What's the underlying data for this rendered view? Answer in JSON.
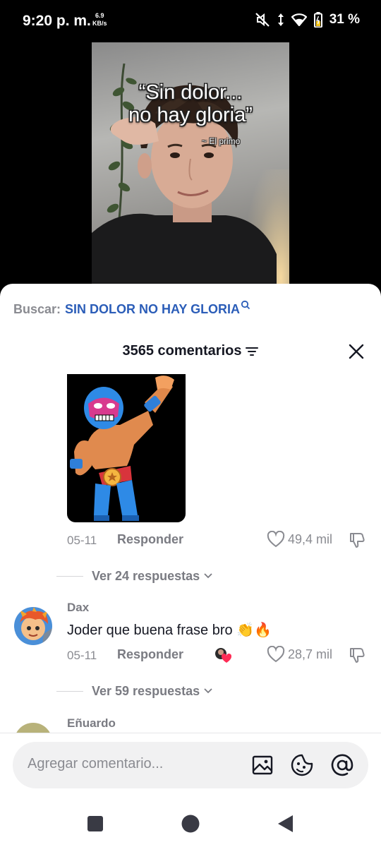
{
  "status_bar": {
    "time": "9:20 p. m.",
    "speed_value": "6.9",
    "speed_unit": "KB/s",
    "battery": "31 %"
  },
  "video": {
    "quote_line1": "“Sin dolor...",
    "quote_line2": "no hay gloria”",
    "quote_author": "~ El primo"
  },
  "search": {
    "prefix": "Buscar:",
    "query": "SIN DOLOR NO HAY GLORIA"
  },
  "comments_header": {
    "title": "3565 comentarios"
  },
  "thread": {
    "first_comment": {
      "date": "05-11",
      "reply_label": "Responder",
      "likes": "49,4 mil",
      "view_replies": "Ver 24 respuestas"
    },
    "second_comment": {
      "username": "Dax",
      "text": "Joder que buena frase bro 👏🔥",
      "date": "05-11",
      "reply_label": "Responder",
      "likes": "28,7 mil",
      "view_replies": "Ver 59 respuestas"
    },
    "third_comment": {
      "username": "Eñuardo"
    }
  },
  "input": {
    "placeholder": "Agregar comentario..."
  },
  "colors": {
    "accent_link": "#2b5db8",
    "muted_text": "#8a8b91",
    "primary_text": "#161823",
    "creator_heart": "#fe2c55"
  },
  "icons": {
    "status": [
      "mute-icon",
      "data-arrows-icon",
      "wifi-icon",
      "battery-icon"
    ],
    "header": [
      "filter-icon",
      "close-icon"
    ],
    "comment": [
      "heart-outline-icon",
      "dislike-icon",
      "chevron-down-icon"
    ],
    "input": [
      "image-icon",
      "emoji-icon",
      "mention-icon"
    ],
    "nav": [
      "recents-square-icon",
      "home-circle-icon",
      "back-triangle-icon"
    ]
  }
}
